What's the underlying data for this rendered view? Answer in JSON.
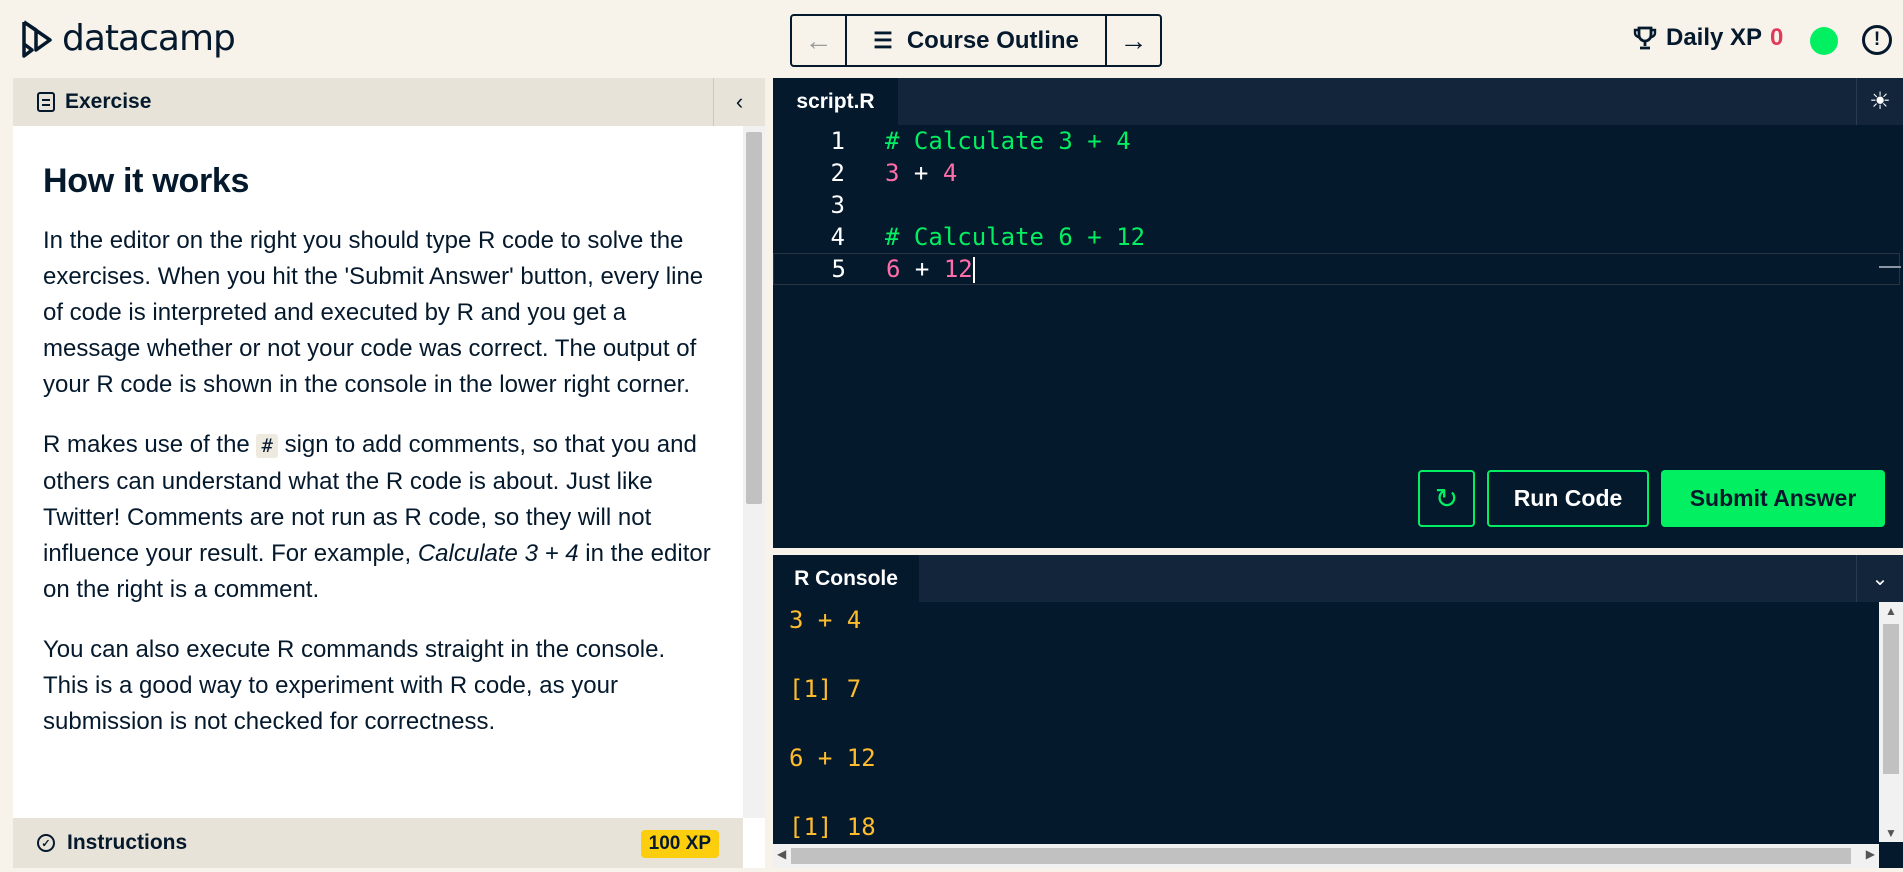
{
  "header": {
    "logo_text": "datacamp",
    "prev_icon": "arrow-left-icon",
    "outline_label": "Course Outline",
    "next_icon": "arrow-right-icon",
    "daily_xp_label": "Daily XP",
    "daily_xp_value": "0",
    "status_color": "#03ef62",
    "alert_icon": "!"
  },
  "exercise": {
    "panel_title": "Exercise",
    "heading": "How it works",
    "p1": "In the editor on the right you should type R code to solve the exercises. When you hit the 'Submit Answer' button, every line of code is interpreted and executed by R and you get a message whether or not your code was correct. The output of your R code is shown in the console in the lower right corner.",
    "p2_a": "R makes use of the",
    "p2_code": "#",
    "p2_b": "sign to add comments, so that you and others can understand what the R code is about. Just like Twitter! Comments are not run as R code, so they will not influence your result. For example,",
    "p2_em": "Calculate 3 + 4",
    "p2_c": "in the editor on the right is a comment.",
    "p3": "You can also execute R commands straight in the console. This is a good way to experiment with R code, as your submission is not checked for correctness.",
    "instructions_label": "Instructions",
    "xp_badge": "100 XP"
  },
  "editor": {
    "tab_label": "script.R",
    "lines": [
      {
        "n": "1",
        "comment": "# Calculate 3 + 4"
      },
      {
        "n": "2",
        "a": "3",
        "op": " + ",
        "b": "4"
      },
      {
        "n": "3"
      },
      {
        "n": "4",
        "comment": "# Calculate 6 + 12"
      },
      {
        "n": "5",
        "a": "6",
        "op": " + ",
        "b": "12"
      }
    ],
    "run_label": "Run Code",
    "submit_label": "Submit Answer"
  },
  "console": {
    "tab_label": "R Console",
    "output": [
      "3 + 4",
      "[1] 7",
      "6 + 12",
      "[1] 18"
    ]
  },
  "colors": {
    "accent_green": "#03ef62",
    "navy": "#05192d",
    "comment": "#03ef62",
    "number": "#ff6ea9",
    "console_text": "#ffbd2e",
    "xp_red": "#e03a59",
    "badge_yellow": "#fcce0d"
  }
}
